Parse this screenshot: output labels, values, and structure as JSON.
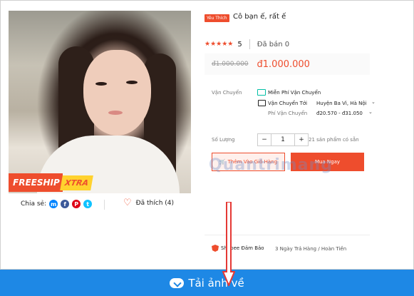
{
  "product": {
    "tag": "Yêu Thích",
    "title": "Cô bạn ế, rất ế",
    "rating_value": "5",
    "stars": "★★★★★",
    "sold": "Đã bán 0",
    "old_price": "đ1.000.000",
    "price": "đ1.000.000"
  },
  "image_badge": {
    "freeship": "FREESHIP",
    "xtra": "XTRA"
  },
  "share": {
    "label": "Chia sẻ:",
    "messenger": "m",
    "facebook": "f",
    "pinterest": "P",
    "twitter": "t"
  },
  "like": {
    "label": "Đã thích (4)"
  },
  "shipping": {
    "label": "Vận Chuyển",
    "free": "Miễn Phí Vận Chuyển",
    "to_label": "Vận Chuyển Tới",
    "to_value": "Huyện Ba Vì, Hà Nội",
    "fee_label": "Phí Vận Chuyển",
    "fee_value": "đ20.570 - đ31.050"
  },
  "quantity": {
    "label": "Số Lượng",
    "minus": "−",
    "value": "1",
    "plus": "+",
    "stock": "21 sản phẩm có sẵn"
  },
  "buttons": {
    "add_to_cart": "Thêm Vào Giỏ Hàng",
    "buy_now": "Mua Ngay"
  },
  "guarantee": {
    "label": "Shopee Đảm Bảo",
    "detail": "3 Ngày Trả Hàng / Hoàn Tiền"
  },
  "watermark": "Quantrimang",
  "download": {
    "label": "Tải ảnh về"
  },
  "colors": {
    "accent": "#ee4d2d",
    "download_bar": "#1e88e5",
    "arrow": "#e53935"
  }
}
